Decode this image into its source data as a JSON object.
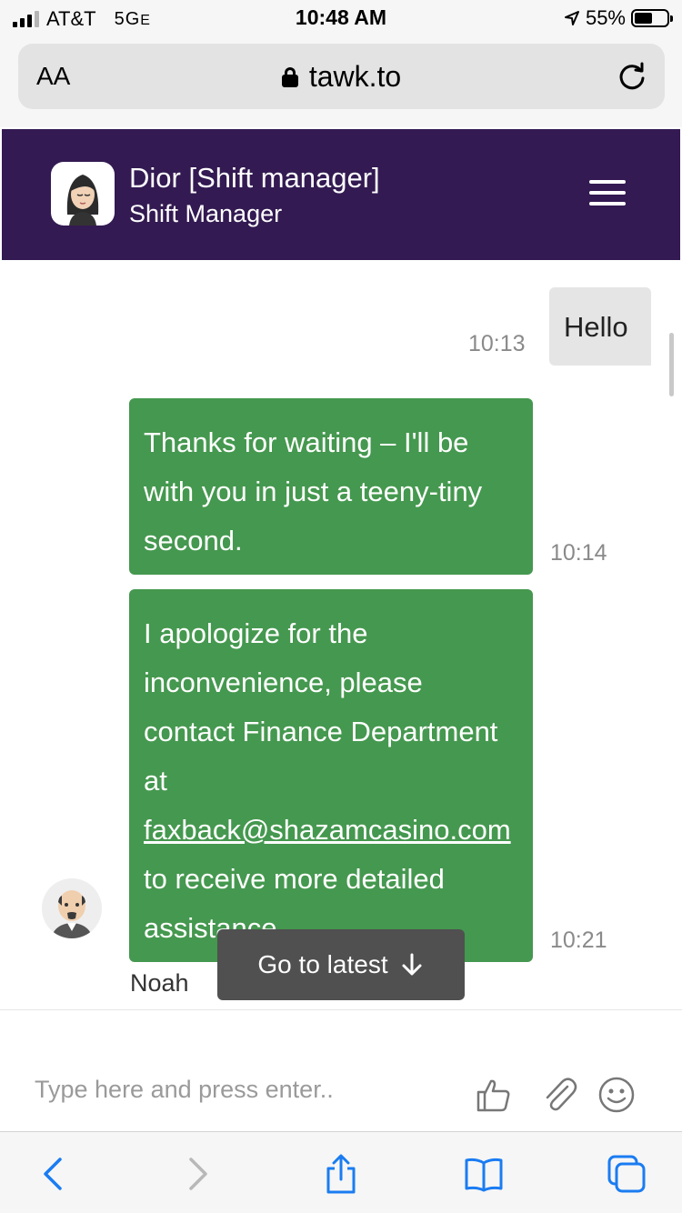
{
  "status_bar": {
    "carrier": "AT&T",
    "network": "5G",
    "network_suffix": "E",
    "time": "10:48 AM",
    "battery": "55%",
    "battery_level": 0.55
  },
  "browser": {
    "text_size_label": "AA",
    "url": "tawk.to"
  },
  "chat_header": {
    "agent_name": "Dior [Shift manager]",
    "agent_role": "Shift Manager"
  },
  "messages": [
    {
      "sender": "visitor",
      "text": "Hello",
      "time": "10:13"
    },
    {
      "sender": "agent",
      "text": "Thanks for waiting – I'll be with you in just a teeny-tiny second.",
      "time": "10:14"
    },
    {
      "sender": "agent",
      "text_before": "I apologize for the inconvenience, please contact Finance Department at ",
      "email": "faxback@shazamcasino.com",
      "text_after": " to receive more detailed assistance.",
      "time": "10:21",
      "author": "Noah"
    }
  ],
  "go_to_latest": "Go to latest",
  "composer": {
    "placeholder": "Type here and press enter.."
  },
  "colors": {
    "header": "#331a52",
    "agent_bubble": "#45984f",
    "visitor_bubble": "#e5e5e5",
    "toolbar_accent": "#1a7cf2"
  },
  "icons": {
    "header_menu": "hamburger-icon",
    "composer": [
      "thumbs-up-icon",
      "paperclip-icon",
      "smiley-icon"
    ],
    "toolbar": [
      "back-icon",
      "forward-icon",
      "share-icon",
      "bookmarks-icon",
      "tabs-icon"
    ]
  }
}
